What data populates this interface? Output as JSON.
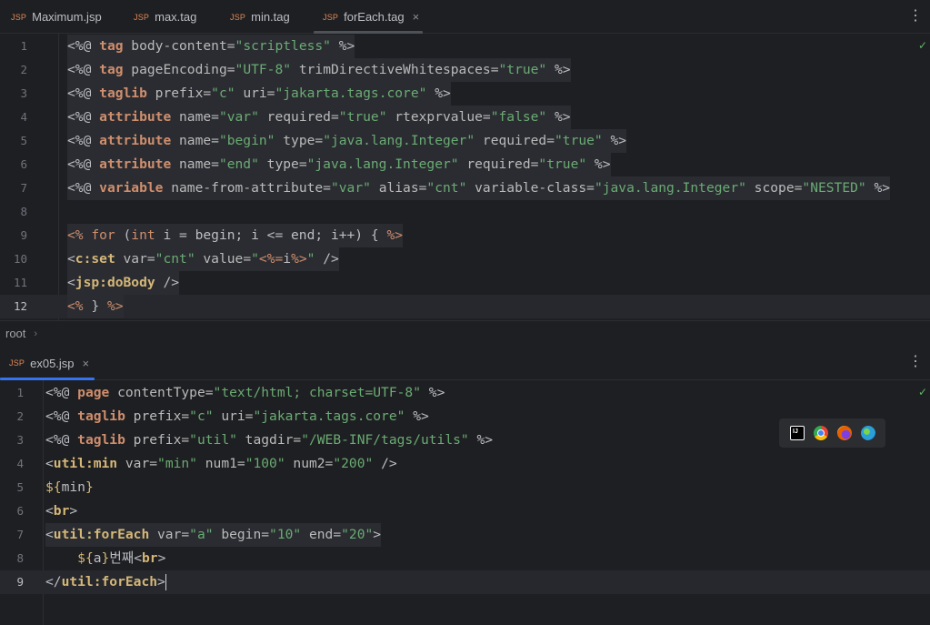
{
  "top_tabs": [
    {
      "prefix": "JSP",
      "label": "Maximum.jsp"
    },
    {
      "prefix": "JSP",
      "label": "max.tag"
    },
    {
      "prefix": "JSP",
      "label": "min.tag"
    },
    {
      "prefix": "JSP",
      "label": "forEach.tag",
      "close": "×"
    }
  ],
  "bottom_tabs": [
    {
      "prefix": "JSP",
      "label": "ex05.jsp",
      "close": "×"
    }
  ],
  "kebab": "⋮",
  "inspection_ok": "✓",
  "breadcrumb": {
    "item": "root",
    "separator": "›"
  },
  "editor_top": {
    "current_line": 12,
    "lines": [
      {
        "n": "1",
        "tokens": [
          [
            "punc",
            "<%@ "
          ],
          [
            "dir",
            "tag"
          ],
          [
            "attr",
            " body-content="
          ],
          [
            "str",
            "\"scriptless\""
          ],
          [
            "punc",
            " %>"
          ]
        ]
      },
      {
        "n": "2",
        "tokens": [
          [
            "punc",
            "<%@ "
          ],
          [
            "dir",
            "tag"
          ],
          [
            "attr",
            " pageEncoding="
          ],
          [
            "str",
            "\"UTF-8\""
          ],
          [
            "attr",
            " trimDirectiveWhitespaces="
          ],
          [
            "str",
            "\"true\""
          ],
          [
            "punc",
            " %>"
          ]
        ]
      },
      {
        "n": "3",
        "tokens": [
          [
            "punc",
            "<%@ "
          ],
          [
            "dir",
            "taglib"
          ],
          [
            "attr",
            " prefix="
          ],
          [
            "str",
            "\"c\""
          ],
          [
            "attr",
            " uri="
          ],
          [
            "str",
            "\"jakarta.tags.core\""
          ],
          [
            "punc",
            " %>"
          ]
        ]
      },
      {
        "n": "4",
        "tokens": [
          [
            "punc",
            "<%@ "
          ],
          [
            "dir",
            "attribute"
          ],
          [
            "attr",
            " name="
          ],
          [
            "str",
            "\"var\""
          ],
          [
            "attr",
            " required="
          ],
          [
            "str",
            "\"true\""
          ],
          [
            "attr",
            " rtexprvalue="
          ],
          [
            "str",
            "\"false\""
          ],
          [
            "punc",
            " %>"
          ]
        ]
      },
      {
        "n": "5",
        "tokens": [
          [
            "punc",
            "<%@ "
          ],
          [
            "dir",
            "attribute"
          ],
          [
            "attr",
            " name="
          ],
          [
            "str",
            "\"begin\""
          ],
          [
            "attr",
            " type="
          ],
          [
            "str",
            "\"java.lang.Integer\""
          ],
          [
            "attr",
            " required="
          ],
          [
            "str",
            "\"true\""
          ],
          [
            "punc",
            " %>"
          ]
        ]
      },
      {
        "n": "6",
        "tokens": [
          [
            "punc",
            "<%@ "
          ],
          [
            "dir",
            "attribute"
          ],
          [
            "attr",
            " name="
          ],
          [
            "str",
            "\"end\""
          ],
          [
            "attr",
            " type="
          ],
          [
            "str",
            "\"java.lang.Integer\""
          ],
          [
            "attr",
            " required="
          ],
          [
            "str",
            "\"true\""
          ],
          [
            "punc",
            " %>"
          ]
        ]
      },
      {
        "n": "7",
        "tokens": [
          [
            "punc",
            "<%@ "
          ],
          [
            "dir",
            "variable"
          ],
          [
            "attr",
            " name-from-attribute="
          ],
          [
            "str",
            "\"var\""
          ],
          [
            "attr",
            " alias="
          ],
          [
            "str",
            "\"cnt\""
          ],
          [
            "attr",
            " variable-class="
          ],
          [
            "str",
            "\"java.lang.Integer\""
          ],
          [
            "attr",
            " scope="
          ],
          [
            "str",
            "\"NESTED\""
          ],
          [
            "punc",
            " %>"
          ]
        ]
      },
      {
        "n": "8",
        "tokens": []
      },
      {
        "n": "9",
        "tokens": [
          [
            "jsp",
            "<% "
          ],
          [
            "kw",
            "for"
          ],
          [
            "txt",
            " ("
          ],
          [
            "kw",
            "int"
          ],
          [
            "txt",
            " i = begin; i <= end; i++) { "
          ],
          [
            "jsp",
            "%>"
          ]
        ]
      },
      {
        "n": "10",
        "tokens": [
          [
            "punc",
            "<"
          ],
          [
            "tag",
            "c:set"
          ],
          [
            "attr",
            " var="
          ],
          [
            "str",
            "\"cnt\""
          ],
          [
            "attr",
            " value="
          ],
          [
            "str",
            "\""
          ],
          [
            "jsp",
            "<%="
          ],
          [
            "txt",
            "i"
          ],
          [
            "jsp",
            "%>"
          ],
          [
            "str",
            "\""
          ],
          [
            "punc",
            " />"
          ]
        ]
      },
      {
        "n": "11",
        "tokens": [
          [
            "punc",
            "<"
          ],
          [
            "tag",
            "jsp:doBody"
          ],
          [
            "punc",
            " />"
          ]
        ]
      },
      {
        "n": "12",
        "tokens": [
          [
            "jsp",
            "<%"
          ],
          [
            "txt",
            " } "
          ],
          [
            "jsp",
            "%>"
          ]
        ]
      }
    ]
  },
  "editor_bottom": {
    "current_line": 9,
    "lines": [
      {
        "n": "1",
        "tokens": [
          [
            "punc",
            "<%@ "
          ],
          [
            "dir",
            "page"
          ],
          [
            "attr",
            " contentType="
          ],
          [
            "str",
            "\"text/html; charset=UTF-8\""
          ],
          [
            "punc",
            " %>"
          ]
        ]
      },
      {
        "n": "2",
        "tokens": [
          [
            "punc",
            "<%@ "
          ],
          [
            "dir",
            "taglib"
          ],
          [
            "attr",
            " prefix="
          ],
          [
            "str",
            "\"c\""
          ],
          [
            "attr",
            " uri="
          ],
          [
            "str",
            "\"jakarta.tags.core\""
          ],
          [
            "punc",
            " %>"
          ]
        ]
      },
      {
        "n": "3",
        "tokens": [
          [
            "punc",
            "<%@ "
          ],
          [
            "dir",
            "taglib"
          ],
          [
            "attr",
            " prefix="
          ],
          [
            "str",
            "\"util\""
          ],
          [
            "attr",
            " tagdir="
          ],
          [
            "str",
            "\"/WEB-INF/tags/utils\""
          ],
          [
            "punc",
            " %>"
          ]
        ]
      },
      {
        "n": "4",
        "tokens": [
          [
            "punc",
            "<"
          ],
          [
            "tag",
            "util:min"
          ],
          [
            "attr",
            " var="
          ],
          [
            "str",
            "\"min\""
          ],
          [
            "attr",
            " num1="
          ],
          [
            "str",
            "\"100\""
          ],
          [
            "attr",
            " num2="
          ],
          [
            "str",
            "\"200\""
          ],
          [
            "punc",
            " />"
          ]
        ]
      },
      {
        "n": "5",
        "tokens": [
          [
            "el",
            "${"
          ],
          [
            "txt",
            "min"
          ],
          [
            "el",
            "}"
          ]
        ]
      },
      {
        "n": "6",
        "tokens": [
          [
            "punc",
            "<"
          ],
          [
            "tag",
            "br"
          ],
          [
            "punc",
            ">"
          ]
        ]
      },
      {
        "n": "7",
        "tokens": [
          [
            "punc",
            "<"
          ],
          [
            "tag",
            "util:forEach"
          ],
          [
            "attr",
            " var="
          ],
          [
            "str",
            "\"a\""
          ],
          [
            "attr",
            " begin="
          ],
          [
            "str",
            "\"10\""
          ],
          [
            "attr",
            " end="
          ],
          [
            "str",
            "\"20\""
          ],
          [
            "punc",
            ">"
          ]
        ]
      },
      {
        "n": "8",
        "tokens": [
          [
            "txt",
            "    "
          ],
          [
            "el",
            "${"
          ],
          [
            "txt",
            "a"
          ],
          [
            "el",
            "}"
          ],
          [
            "txt",
            "번째"
          ],
          [
            "punc",
            "<"
          ],
          [
            "tag",
            "br"
          ],
          [
            "punc",
            ">"
          ]
        ]
      },
      {
        "n": "9",
        "tokens": [
          [
            "punc",
            "</"
          ],
          [
            "tag",
            "util:forEach"
          ],
          [
            "punc",
            ">"
          ]
        ]
      }
    ]
  },
  "browser_icons": [
    {
      "name": "intellij-icon",
      "label": "IJ",
      "color": "#1a1a2e"
    },
    {
      "name": "chrome-icon",
      "color": "#4285f4"
    },
    {
      "name": "firefox-icon",
      "color": "#e66000"
    },
    {
      "name": "edge-icon",
      "color": "#2a9fd8"
    }
  ]
}
